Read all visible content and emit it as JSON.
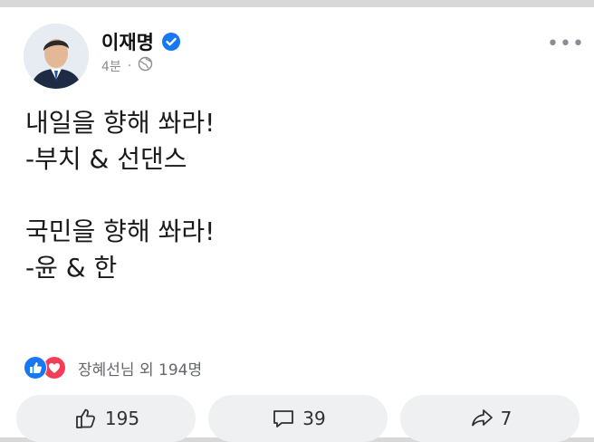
{
  "post": {
    "author": "이재명",
    "time": "4분",
    "separator": "·",
    "more_label": "•••",
    "lines": [
      "내일을 향해 쏴라!",
      "-부치 & 선댄스",
      " ",
      "국민을 향해 쏴라!",
      "-윤 & 한"
    ]
  },
  "reactions": {
    "summary": "장혜선님 외 194명"
  },
  "actions": {
    "like_count": "195",
    "comment_count": "39",
    "share_count": "7"
  },
  "colors": {
    "like_blue": "#1877f2",
    "love_red": "#f33e58",
    "verified_blue": "#1877f2",
    "button_bg": "#eef0f2"
  },
  "icons": [
    "verified-badge-icon",
    "globe-icon",
    "more-icon",
    "like-icon",
    "love-icon",
    "thumbs-up-icon",
    "comment-icon",
    "share-icon"
  ]
}
